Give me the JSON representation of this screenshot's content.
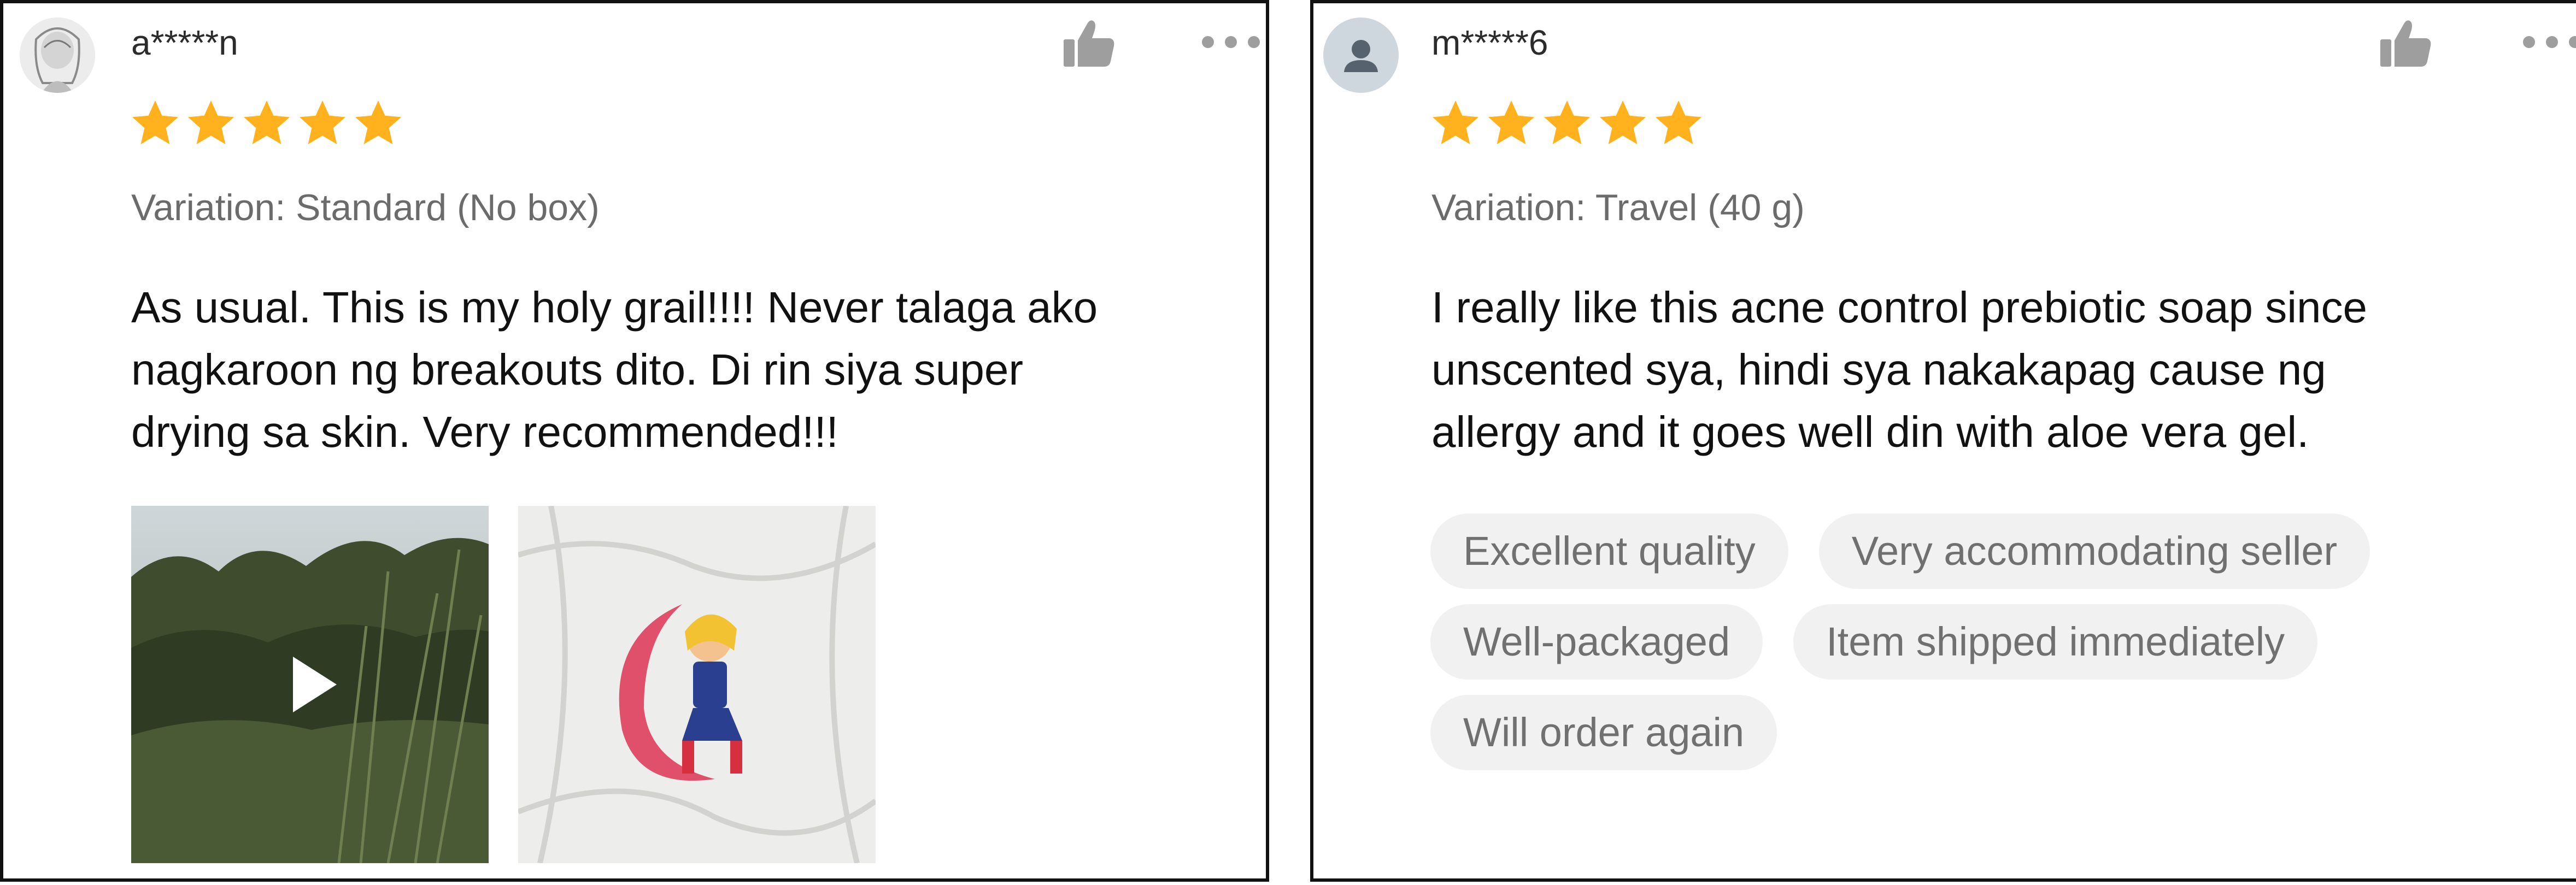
{
  "reviews": [
    {
      "username": "a*****n",
      "rating": 5,
      "rating_max": 5,
      "variation": "Variation: Standard (No box)",
      "text_lines": [
        "As usual. This is my holy grail!!!! Never talaga ako",
        "nagkaroon ng breakouts dito. Di rin siya super",
        "drying sa skin. Very recommended!!!"
      ],
      "media": [
        {
          "type": "video",
          "icon": "play-icon"
        },
        {
          "type": "photo"
        }
      ]
    },
    {
      "username": "m*****6",
      "rating": 5,
      "rating_max": 5,
      "variation": "Variation: Travel (40 g)",
      "text_lines": [
        "I really like this acne control prebiotic soap since",
        "unscented sya, hindi sya nakakapag cause ng",
        "allergy and it goes well din with aloe vera gel."
      ],
      "tags": [
        "Excellent quality",
        "Very accommodating seller",
        "Well-packaged",
        "Item shipped immediately",
        "Will order again"
      ]
    }
  ],
  "icons": {
    "like": "thumbs-up-icon",
    "more": "more-options-icon",
    "star": "star-icon",
    "default_avatar": "user-icon"
  },
  "colors": {
    "star": "#FFB21D",
    "icon_gray": "#9e9e9e",
    "tag_bg": "#f1f1f1",
    "tag_text": "#707070",
    "variation_text": "#6b6b6b",
    "border": "#111111"
  }
}
